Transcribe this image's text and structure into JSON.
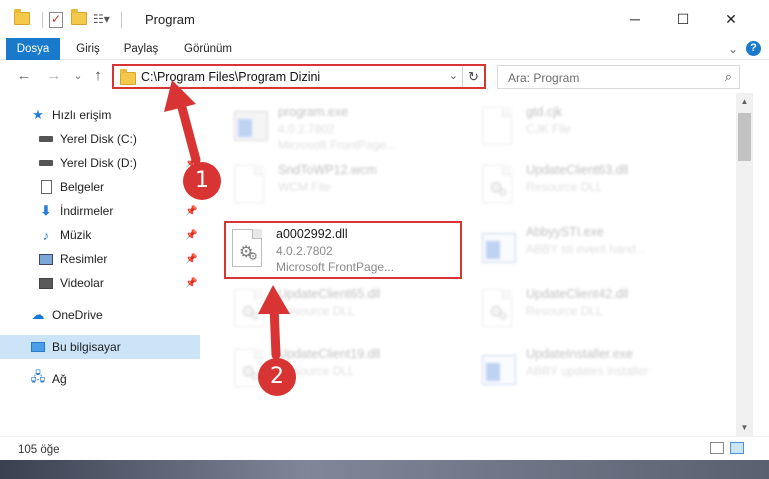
{
  "window": {
    "title": "Program",
    "minimize": "─",
    "maximize": "☐",
    "close": "✕"
  },
  "ribbon": {
    "tabs": [
      "Dosya",
      "Giriş",
      "Paylaş",
      "Görünüm"
    ],
    "collapse": "⌄",
    "help": "?"
  },
  "nav": {
    "back": "←",
    "forward": "→",
    "recent": "⌄",
    "up": "↑",
    "address": "C:\\Program Files\\Program Dizini",
    "address_dropdown": "⌄",
    "refresh": "↻",
    "search_placeholder": "Ara: Program",
    "search_icon": "⌕"
  },
  "sidebar": {
    "items": [
      {
        "label": "Hızlı erişim",
        "icon": "star-icon"
      },
      {
        "label": "Yerel Disk (C:)",
        "icon": "drive-icon"
      },
      {
        "label": "Yerel Disk (D:)",
        "icon": "drive-icon"
      },
      {
        "label": "Belgeler",
        "icon": "documents-icon"
      },
      {
        "label": "İndirmeler",
        "icon": "download-icon"
      },
      {
        "label": "Müzik",
        "icon": "music-icon"
      },
      {
        "label": "Resimler",
        "icon": "pictures-icon"
      },
      {
        "label": "Videolar",
        "icon": "videos-icon"
      },
      {
        "label": "OneDrive",
        "icon": "cloud-icon"
      },
      {
        "label": "Bu bilgisayar",
        "icon": "computer-icon"
      },
      {
        "label": "Ağ",
        "icon": "network-icon"
      }
    ]
  },
  "files": [
    {
      "name": "program.exe",
      "line2": "4.0.2.7802",
      "line3": "Microsoft FrontPage...",
      "kind": "exe"
    },
    {
      "name": "gtd.cjk",
      "line2": "CJK File",
      "line3": "",
      "kind": "doc"
    },
    {
      "name": "SndToWP12.wcm",
      "line2": "WCM File",
      "line3": "",
      "kind": "doc"
    },
    {
      "name": "UpdateClient63.dll",
      "line2": "Resource DLL",
      "line3": "",
      "kind": "dll"
    },
    {
      "name": "a0002992.dll",
      "line2": "4.0.2.7802",
      "line3": "Microsoft FrontPage...",
      "kind": "dll"
    },
    {
      "name": "AbbyySTI.exe",
      "line2": "ABBY sti event hand...",
      "line3": "",
      "kind": "app"
    },
    {
      "name": "UpdateClient65.dll",
      "line2": "Resource DLL",
      "line3": "",
      "kind": "dll"
    },
    {
      "name": "UpdateClient42.dll",
      "line2": "Resource DLL",
      "line3": "",
      "kind": "dll"
    },
    {
      "name": "UpdateClient19.dll",
      "line2": "Resource DLL",
      "line3": "",
      "kind": "dll"
    },
    {
      "name": "UpdateInstaller.exe",
      "line2": "ABBY updates installer",
      "line3": "",
      "kind": "app"
    }
  ],
  "status": {
    "count": "105 öğe"
  },
  "annotations": {
    "step1": "1",
    "step2": "2"
  },
  "colors": {
    "accent": "#1979ca",
    "highlight": "#d93434",
    "selected_nav": "#cce4f7"
  }
}
